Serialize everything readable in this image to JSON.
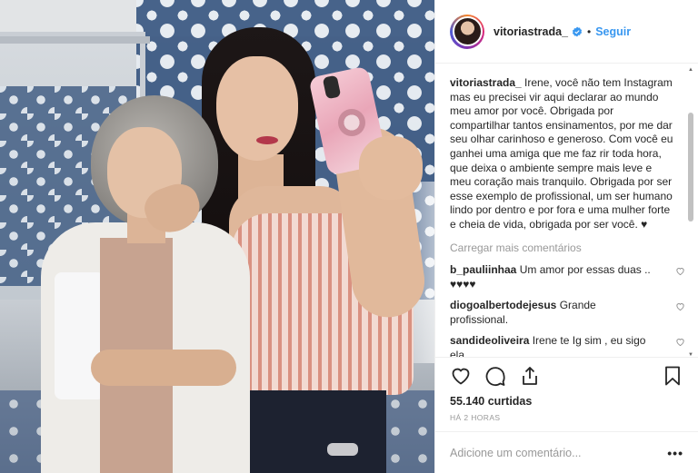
{
  "post": {
    "username": "vitoriastrada_",
    "separator": "•",
    "follow_label": "Seguir",
    "caption": {
      "username": "vitoriastrada_",
      "text": " Irene, você não tem Instagram mas eu precisei vir aqui declarar ao mundo meu amor por você. Obrigada por compartilhar tantos ensinamentos, por me dar seu olhar carinhoso e generoso. Com você eu ganhei uma amiga que me faz rir toda hora, que deixa o ambiente sempre mais leve e meu coração mais tranquilo. Obrigada por ser esse exemplo de profissional, um ser humano lindo por dentro e por fora e uma mulher forte e cheia de vida, obrigada por ser você. ♥"
    },
    "load_more_label": "Carregar mais comentários",
    "comments": [
      {
        "username": "b_pauliinhaa",
        "text": " Um amor por essas duas .. ♥♥♥♥"
      },
      {
        "username": "diogoalbertodejesus",
        "text": " Grande profissional."
      },
      {
        "username": "sandideoliveira",
        "text": " Irene te Ig sim , eu sigo ela"
      }
    ],
    "likes": "55.140 curtidas",
    "timestamp": "HÁ 2 HORAS",
    "add_comment_placeholder": "Adicione um comentário...",
    "more_label": "•••"
  },
  "icons": {
    "verified": "verified-badge-icon",
    "like": "heart-icon",
    "comment": "comment-bubble-icon",
    "share": "share-icon",
    "save": "bookmark-icon"
  },
  "colors": {
    "follow": "#3897f0",
    "secondary_text": "#999999",
    "border": "#efefef"
  }
}
